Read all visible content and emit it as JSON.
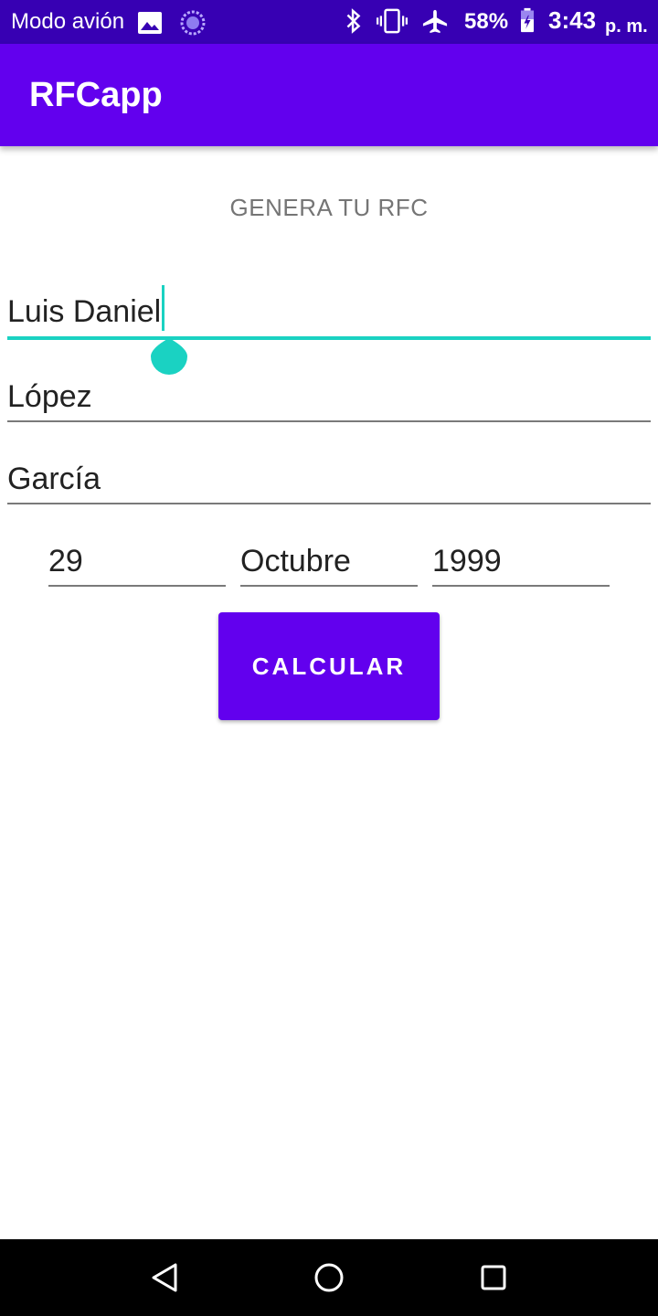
{
  "status_bar": {
    "mode_text": "Modo avión",
    "battery_percent": "58%",
    "time": "3:43",
    "ampm": "p. m.",
    "icons": [
      "image-icon",
      "loading-icon",
      "bluetooth-icon",
      "vibrate-icon",
      "airplane-icon",
      "battery-icon"
    ]
  },
  "app_bar": {
    "title": "RFCapp"
  },
  "main": {
    "subtitle": "GENERA TU RFC",
    "nombre": "Luis Daniel",
    "apellido_paterno": "López",
    "apellido_materno": "García",
    "dia": "29",
    "mes": "Octubre",
    "anio": "1999",
    "button_label": "CALCULAR"
  },
  "colors": {
    "status_bar": "#3700b3",
    "primary": "#6200ee",
    "accent": "#1ad2c2"
  },
  "nav_bar": {
    "icons": [
      "back-icon",
      "home-icon",
      "recent-apps-icon"
    ]
  }
}
